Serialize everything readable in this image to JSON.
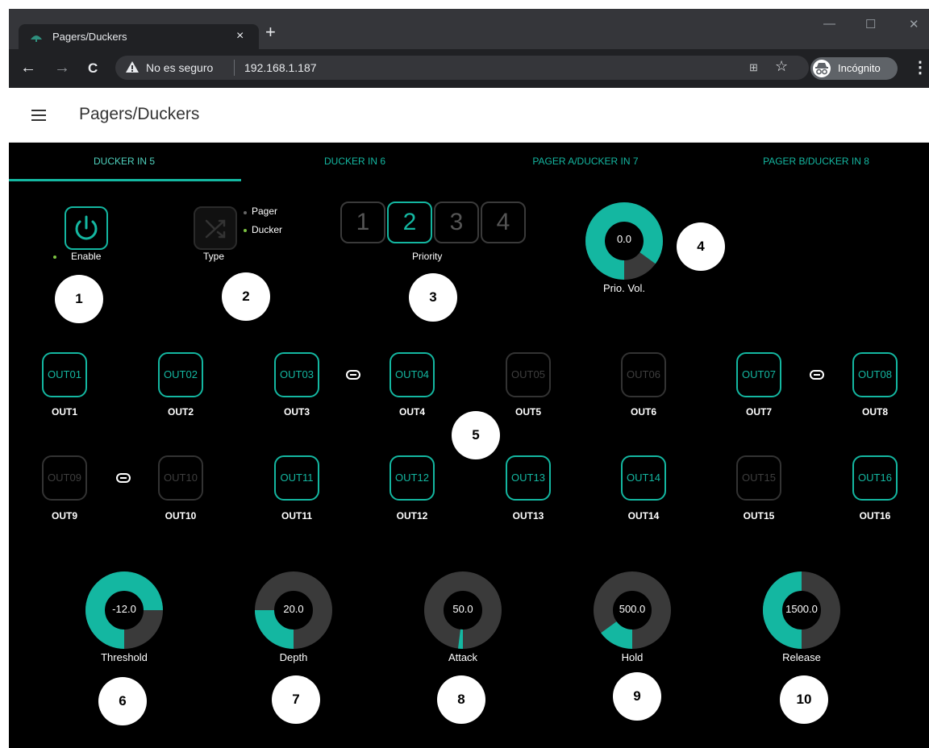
{
  "browser": {
    "tab_title": "Pagers/Duckers",
    "tab_close": "×",
    "new_tab": "+",
    "security_text": "No es seguro",
    "url": "192.168.1.187",
    "incognito_label": "Incógnito",
    "menu_dots": "⋮",
    "back": "←",
    "forward": "→",
    "reload": "C",
    "star": "☆",
    "translate": "⊞",
    "minimize": "—",
    "maximize": "☐",
    "close": "✕"
  },
  "app": {
    "title": "Pagers/Duckers"
  },
  "tabs": [
    {
      "label": "DUCKER IN 5",
      "active": true
    },
    {
      "label": "DUCKER IN 6",
      "active": false
    },
    {
      "label": "PAGER A/DUCKER IN 7",
      "active": false
    },
    {
      "label": "PAGER B/DUCKER IN 8",
      "active": false
    }
  ],
  "enable": {
    "label": "Enable",
    "on": true
  },
  "type": {
    "label": "Type",
    "options": [
      "Pager",
      "Ducker"
    ],
    "selected": "Ducker"
  },
  "priority": {
    "label": "Priority",
    "options": [
      "1",
      "2",
      "3",
      "4"
    ],
    "selected": "2"
  },
  "prio_vol": {
    "label": "Prio. Vol.",
    "value": "0.0",
    "level": 0.85
  },
  "badges": [
    "1",
    "2",
    "3",
    "4",
    "5",
    "6",
    "7",
    "8",
    "9",
    "10"
  ],
  "outputs": [
    {
      "button": "OUT01",
      "label": "OUT1",
      "active": true
    },
    {
      "button": "OUT02",
      "label": "OUT2",
      "active": true
    },
    {
      "button": "OUT03",
      "label": "OUT3",
      "active": true
    },
    {
      "button": "OUT04",
      "label": "OUT4",
      "active": true
    },
    {
      "button": "OUT05",
      "label": "OUT5",
      "active": false
    },
    {
      "button": "OUT06",
      "label": "OUT6",
      "active": false
    },
    {
      "button": "OUT07",
      "label": "OUT7",
      "active": true
    },
    {
      "button": "OUT08",
      "label": "OUT8",
      "active": true
    },
    {
      "button": "OUT09",
      "label": "OUT9",
      "active": false
    },
    {
      "button": "OUT10",
      "label": "OUT10",
      "active": false
    },
    {
      "button": "OUT11",
      "label": "OUT11",
      "active": true
    },
    {
      "button": "OUT12",
      "label": "OUT12",
      "active": true
    },
    {
      "button": "OUT13",
      "label": "OUT13",
      "active": true
    },
    {
      "button": "OUT14",
      "label": "OUT14",
      "active": true
    },
    {
      "button": "OUT15",
      "label": "OUT15",
      "active": false
    },
    {
      "button": "OUT16",
      "label": "OUT16",
      "active": true
    }
  ],
  "links": [
    "OUT3-OUT4",
    "OUT7-OUT8",
    "OUT9-OUT10"
  ],
  "knobs": [
    {
      "label": "Threshold",
      "value": "-12.0",
      "level": 0.75
    },
    {
      "label": "Depth",
      "value": "20.0",
      "level": 0.25
    },
    {
      "label": "Attack",
      "value": "50.0",
      "level": 0.02
    },
    {
      "label": "Hold",
      "value": "500.0",
      "level": 0.15
    },
    {
      "label": "Release",
      "value": "1500.0",
      "level": 0.5
    }
  ],
  "colors": {
    "accent": "#14b7a1",
    "track": "#3a3a3a",
    "background": "#000000",
    "enable_dot": "#7cc242"
  }
}
